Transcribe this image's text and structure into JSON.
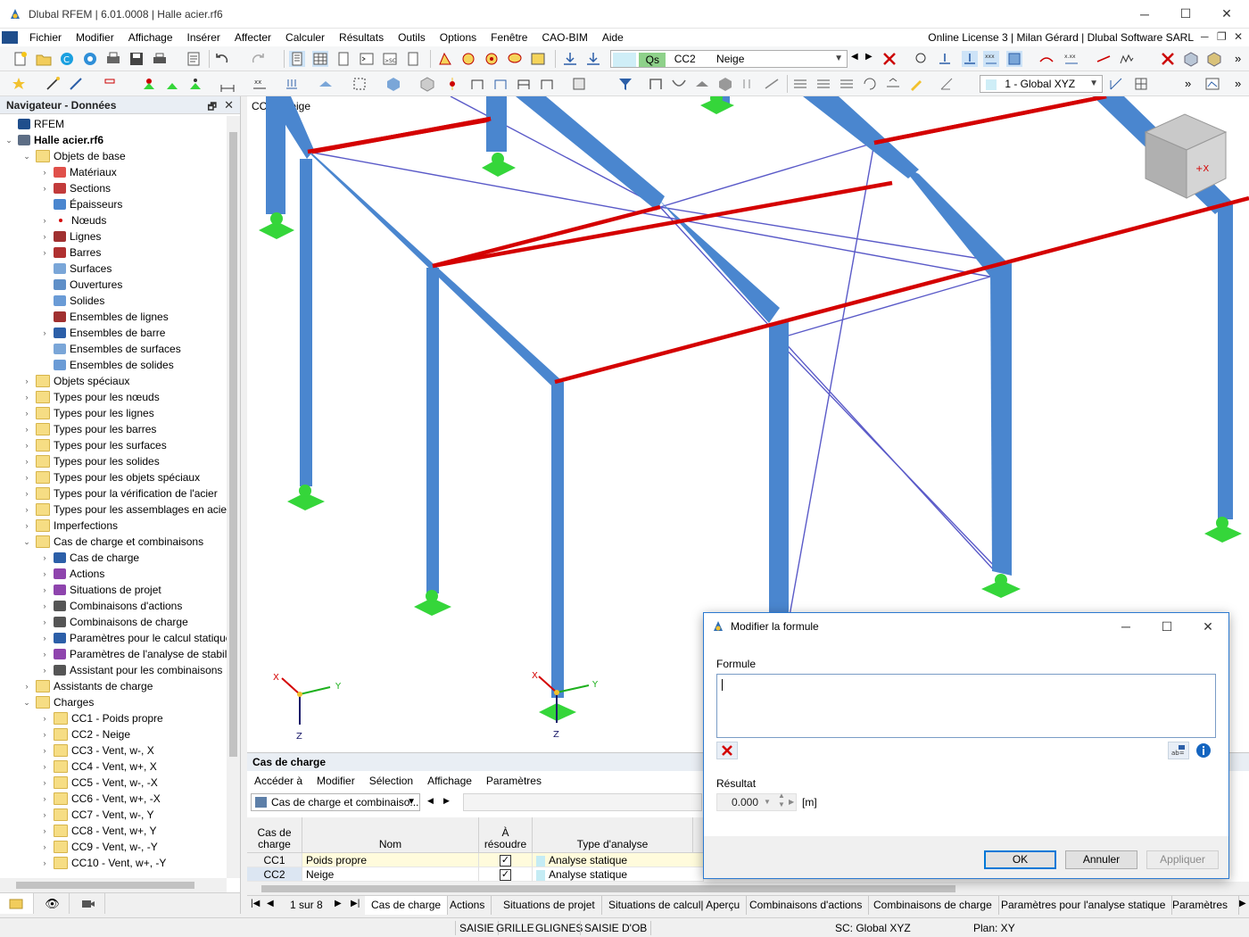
{
  "window": {
    "title": "Dlubal RFEM | 6.01.0008 | Halle acier.rf6",
    "minimize": "─",
    "maximize": "☐",
    "close": "✕"
  },
  "menubar": {
    "items": [
      "Fichier",
      "Modifier",
      "Affichage",
      "Insérer",
      "Affecter",
      "Calculer",
      "Résultats",
      "Outils",
      "Options",
      "Fenêtre",
      "CAO-BIM",
      "Aide"
    ],
    "license": "Online License 3 | Milan Gérard | Dlubal Software SARL",
    "mdi_min": "─",
    "mdi_restore": "❐",
    "mdi_close": "✕"
  },
  "toolbar": {
    "loadcase_tag": "Qs",
    "loadcase_id": "CC2",
    "loadcase_name": "Neige",
    "coord_system": "1 - Global XYZ",
    "overflow": "»"
  },
  "navigator": {
    "title": "Navigateur - Données",
    "items": [
      {
        "label": "RFEM",
        "level": 0,
        "exp": "",
        "icon": "rfem-icon"
      },
      {
        "label": "Halle acier.rf6",
        "level": 0,
        "exp": "▼",
        "icon": "model-icon",
        "bold": true
      },
      {
        "label": "Objets de base",
        "level": 1,
        "exp": "▼",
        "icon": "folder-icon"
      },
      {
        "label": "Matériaux",
        "level": 2,
        "exp": "›",
        "icon": "materials-icon"
      },
      {
        "label": "Sections",
        "level": 2,
        "exp": "›",
        "icon": "sections-icon"
      },
      {
        "label": "Épaisseurs",
        "level": 2,
        "exp": "",
        "icon": "thickness-icon"
      },
      {
        "label": "Nœuds",
        "level": 2,
        "exp": "›",
        "icon": "nodes-icon"
      },
      {
        "label": "Lignes",
        "level": 2,
        "exp": "›",
        "icon": "lines-icon"
      },
      {
        "label": "Barres",
        "level": 2,
        "exp": "›",
        "icon": "members-icon"
      },
      {
        "label": "Surfaces",
        "level": 2,
        "exp": "",
        "icon": "surfaces-icon"
      },
      {
        "label": "Ouvertures",
        "level": 2,
        "exp": "",
        "icon": "openings-icon"
      },
      {
        "label": "Solides",
        "level": 2,
        "exp": "",
        "icon": "solids-icon"
      },
      {
        "label": "Ensembles de lignes",
        "level": 2,
        "exp": "",
        "icon": "line-sets-icon"
      },
      {
        "label": "Ensembles de barre",
        "level": 2,
        "exp": "›",
        "icon": "member-sets-icon"
      },
      {
        "label": "Ensembles de surfaces",
        "level": 2,
        "exp": "",
        "icon": "surface-sets-icon"
      },
      {
        "label": "Ensembles de solides",
        "level": 2,
        "exp": "",
        "icon": "solid-sets-icon"
      },
      {
        "label": "Objets spéciaux",
        "level": 1,
        "exp": "›",
        "icon": "folder-icon"
      },
      {
        "label": "Types pour les nœuds",
        "level": 1,
        "exp": "›",
        "icon": "folder-icon"
      },
      {
        "label": "Types pour les lignes",
        "level": 1,
        "exp": "›",
        "icon": "folder-icon"
      },
      {
        "label": "Types pour les barres",
        "level": 1,
        "exp": "›",
        "icon": "folder-icon"
      },
      {
        "label": "Types pour les surfaces",
        "level": 1,
        "exp": "›",
        "icon": "folder-icon"
      },
      {
        "label": "Types pour les solides",
        "level": 1,
        "exp": "›",
        "icon": "folder-icon"
      },
      {
        "label": "Types pour les objets spéciaux",
        "level": 1,
        "exp": "›",
        "icon": "folder-icon"
      },
      {
        "label": "Types pour la vérification de l'acier",
        "level": 1,
        "exp": "›",
        "icon": "folder-icon"
      },
      {
        "label": "Types pour les assemblages en acier",
        "level": 1,
        "exp": "›",
        "icon": "folder-icon"
      },
      {
        "label": "Imperfections",
        "level": 1,
        "exp": "›",
        "icon": "folder-icon"
      },
      {
        "label": "Cas de charge et combinaisons",
        "level": 1,
        "exp": "▼",
        "icon": "folder-icon"
      },
      {
        "label": "Cas de charge",
        "level": 2,
        "exp": "›",
        "icon": "load-cases-icon"
      },
      {
        "label": "Actions",
        "level": 2,
        "exp": "›",
        "icon": "actions-icon"
      },
      {
        "label": "Situations de projet",
        "level": 2,
        "exp": "›",
        "icon": "design-situations-icon"
      },
      {
        "label": "Combinaisons d'actions",
        "level": 2,
        "exp": "›",
        "icon": "action-combinations-icon"
      },
      {
        "label": "Combinaisons de charge",
        "level": 2,
        "exp": "›",
        "icon": "load-combinations-icon"
      },
      {
        "label": "Paramètres pour le calcul statique",
        "level": 2,
        "exp": "›",
        "icon": "static-settings-icon"
      },
      {
        "label": "Paramètres de l'analyse de stabilité",
        "level": 2,
        "exp": "›",
        "icon": "stability-settings-icon"
      },
      {
        "label": "Assistant pour les combinaisons",
        "level": 2,
        "exp": "›",
        "icon": "combination-wizard-icon"
      },
      {
        "label": "Assistants de charge",
        "level": 1,
        "exp": "›",
        "icon": "folder-icon"
      },
      {
        "label": "Charges",
        "level": 1,
        "exp": "▼",
        "icon": "folder-icon"
      },
      {
        "label": "CC1 - Poids propre",
        "level": 2,
        "exp": "›",
        "icon": "folder-icon"
      },
      {
        "label": "CC2 - Neige",
        "level": 2,
        "exp": "›",
        "icon": "folder-icon"
      },
      {
        "label": "CC3 - Vent, w-, X",
        "level": 2,
        "exp": "›",
        "icon": "folder-icon"
      },
      {
        "label": "CC4 - Vent, w+, X",
        "level": 2,
        "exp": "›",
        "icon": "folder-icon"
      },
      {
        "label": "CC5 - Vent, w-, -X",
        "level": 2,
        "exp": "›",
        "icon": "folder-icon"
      },
      {
        "label": "CC6 - Vent, w+, -X",
        "level": 2,
        "exp": "›",
        "icon": "folder-icon"
      },
      {
        "label": "CC7 - Vent, w-, Y",
        "level": 2,
        "exp": "›",
        "icon": "folder-icon"
      },
      {
        "label": "CC8 - Vent, w+, Y",
        "level": 2,
        "exp": "›",
        "icon": "folder-icon"
      },
      {
        "label": "CC9 - Vent, w-, -Y",
        "level": 2,
        "exp": "›",
        "icon": "folder-icon"
      },
      {
        "label": "CC10 - Vent, w+, -Y",
        "level": 2,
        "exp": "›",
        "icon": "folder-icon"
      }
    ]
  },
  "viewport": {
    "label": "CC2 - Neige",
    "axis_x": "X",
    "axis_y": "Y",
    "axis_z": "Z"
  },
  "panel": {
    "title": "Cas de charge",
    "menu": [
      "Accéder à",
      "Modifier",
      "Sélection",
      "Affichage",
      "Paramètres"
    ],
    "combo": "Cas de charge et combinaiso...",
    "columns": {
      "case": "Cas de\ncharge",
      "name": "Nom",
      "solve": "À\nrésoudre",
      "analysis": "Type d'analyse"
    },
    "rows": [
      {
        "id": "CC1",
        "name": "Poids propre",
        "solve": "✓",
        "analysis": "Analyse statique"
      },
      {
        "id": "CC2",
        "name": "Neige",
        "solve": "✓",
        "analysis": "Analyse statique"
      }
    ],
    "page": "1 sur 8",
    "tabs": [
      "Cas de charge",
      "Actions",
      "Situations de projet",
      "Situations de calcul| Aperçu",
      "Combinaisons d'actions",
      "Combinaisons de charge",
      "Paramètres pour l'analyse statique",
      "Paramètres"
    ]
  },
  "statusbar": {
    "items": [
      "SAISIE",
      "GRILLE",
      "GLIGNES",
      "SAISIE D'OB"
    ],
    "cs": "SC: Global XYZ",
    "plane": "Plan: XY"
  },
  "dialog": {
    "title": "Modifier la formule",
    "formula_label": "Formule",
    "formula_value": "",
    "result_label": "Résultat",
    "result_value": "0.000",
    "result_unit": "[m]",
    "ok": "OK",
    "cancel": "Annuler",
    "apply": "Appliquer"
  },
  "colors": {
    "steel": "#4a86cf",
    "purlin": "#d40000",
    "support": "#35d63a",
    "bracing": "#5a5ac8",
    "accent": "#0078d7"
  }
}
